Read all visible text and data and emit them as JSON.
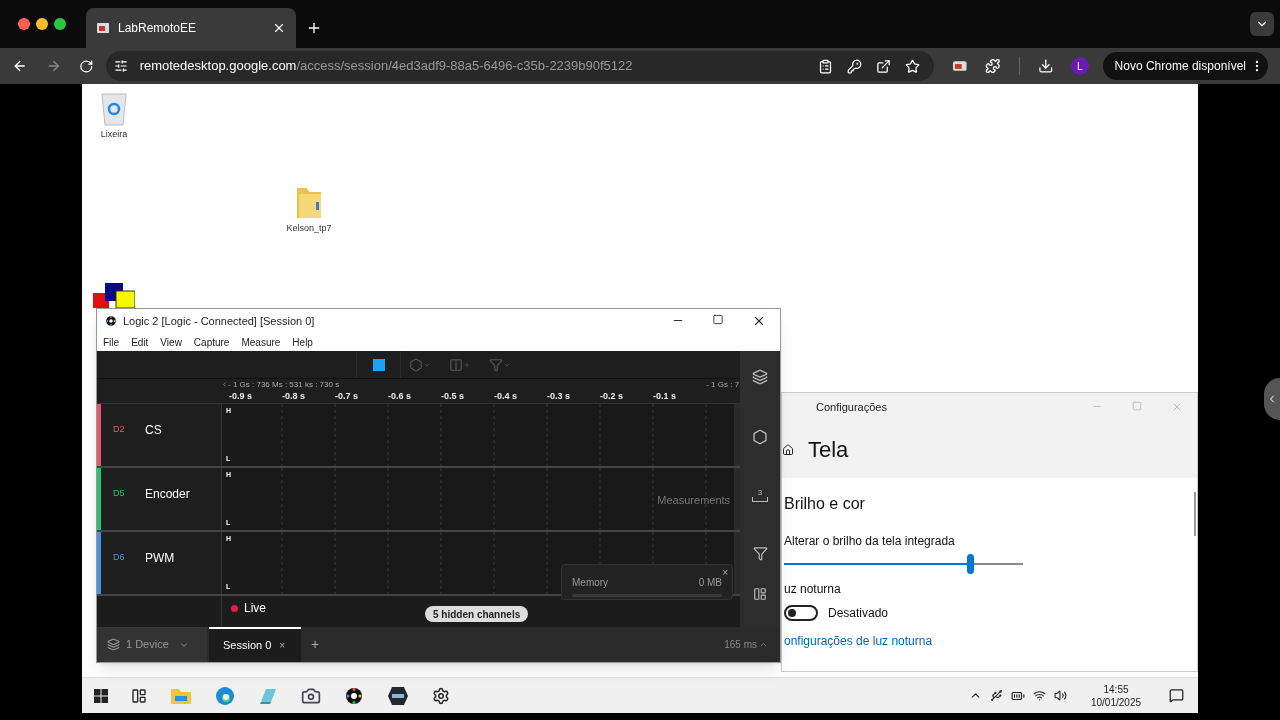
{
  "browser": {
    "tab_title": "LabRemotoEE",
    "url_host": "remotedesktop.google.com",
    "url_path": "/access/session/4ed3adf9-88a5-6496-c35b-2239b90f5122",
    "profile_initial": "L",
    "update_button": "Novo Chrome disponível"
  },
  "desktop_icons": [
    {
      "kind": "recycle-bin",
      "label": "Lixeira"
    },
    {
      "kind": "folder",
      "label": "Kelson_tp7"
    }
  ],
  "logic_window": {
    "title": "Logic 2 [Logic - Connected] [Session 0]",
    "menu": [
      "File",
      "Edit",
      "View",
      "Capture",
      "Measure",
      "Help"
    ],
    "ruler": {
      "left": "- 1 Gs : 736 Ms : 531 ks : 730 s",
      "right": "- 1 Gs : 7",
      "ticks": [
        "-0.9 s",
        "-0.8 s",
        "-0.7 s",
        "-0.6 s",
        "-0.5 s",
        "-0.4 s",
        "-0.3 s",
        "-0.2 s",
        "-0.1 s"
      ]
    },
    "channels": [
      {
        "id": "D2",
        "name": "CS",
        "color": "#e8556f",
        "high": "H",
        "low": "L"
      },
      {
        "id": "D5",
        "name": "Encoder",
        "color": "#2fbf71",
        "high": "H",
        "low": "L"
      },
      {
        "id": "D6",
        "name": "PWM",
        "color": "#4a90e2",
        "high": "H",
        "low": "L"
      }
    ],
    "measurements_label": "Measurements",
    "memory": {
      "label": "Memory",
      "value": "0 MB",
      "close": "×"
    },
    "live": "Live",
    "hidden_channels": "5 hidden channels",
    "device": "1 Device",
    "session_tab": {
      "label": "Session 0",
      "close": "×",
      "selected": true
    },
    "new_tab": "+",
    "latency": "165 ms",
    "sidebar_marker_count": "3"
  },
  "settings_window": {
    "title": "Configurações",
    "page": "Tela",
    "section": "Brilho e cor",
    "brightness": {
      "label": "Alterar o brilho da tela integrada",
      "level": 0.78
    },
    "night_light": {
      "label": "uz noturna",
      "on": false,
      "state": "Desativado"
    },
    "link": "onfigurações de luz noturna"
  },
  "taskbar": {
    "time": "14:55",
    "date": "10/01/2025"
  }
}
